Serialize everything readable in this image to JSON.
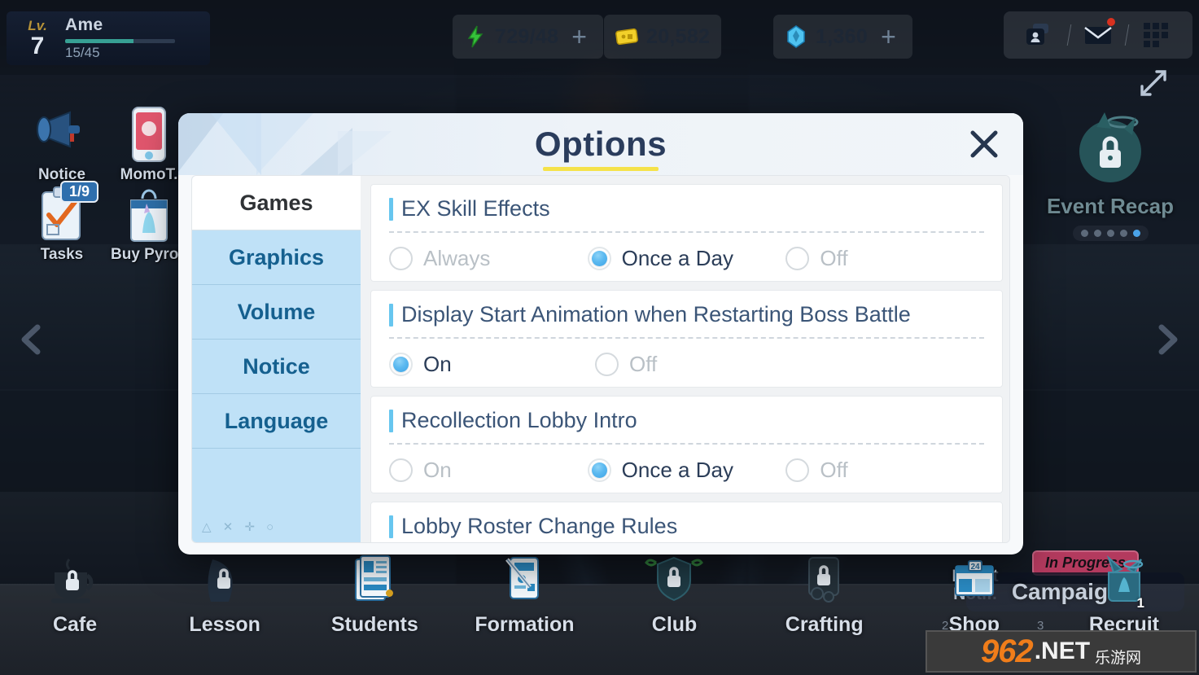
{
  "hud": {
    "player": {
      "lv_word": "Lv.",
      "level": "7",
      "name": "Ame",
      "xp": "15/45"
    },
    "currencies": [
      {
        "name": "ap",
        "icon": "lightning-icon",
        "value": "729/48",
        "plus": "+"
      },
      {
        "name": "credits",
        "icon": "credit-icon",
        "value": "20,582",
        "plus": ""
      },
      {
        "name": "pyroxene",
        "icon": "pyroxene-icon",
        "value": "1,360",
        "plus": "+"
      }
    ],
    "top_right": [
      {
        "name": "friends-icon",
        "label": "Friends"
      },
      {
        "name": "mail-icon",
        "label": "Mail",
        "badge": true
      },
      {
        "name": "menu-grid-icon",
        "label": "Menu"
      }
    ],
    "expand_icon": "expand-arrows-icon"
  },
  "shortcuts": [
    {
      "name": "notice",
      "label": "Notice",
      "icon": "megaphone-icon",
      "badge": ""
    },
    {
      "name": "momotalk",
      "label": "MomoT.",
      "icon": "phone-icon",
      "badge": ""
    },
    {
      "name": "tasks",
      "label": "Tasks",
      "icon": "clipboard-check-icon",
      "badge": "1/9"
    },
    {
      "name": "buy-pyroxene",
      "label": "Buy Pyrox",
      "icon": "pyroxene-bag-icon",
      "badge": ""
    }
  ],
  "right_panel": {
    "label": "Event Recap",
    "locked": true,
    "dots": 5,
    "active_dot": 5
  },
  "event_notif": {
    "line1": "Event",
    "line2": "Notif."
  },
  "campaign": {
    "label": "Campaign",
    "suffix": "x",
    "badge": "In Progress"
  },
  "nav_arrows": {
    "left": "chevron-left-icon",
    "right": "chevron-right-icon"
  },
  "page_numbers": [
    "2",
    "3"
  ],
  "bottom_nav": [
    {
      "name": "cafe",
      "label": "Cafe",
      "icon": "coffee-cup-icon",
      "locked": true,
      "badge": ""
    },
    {
      "name": "lesson",
      "label": "Lesson",
      "icon": "lesson-icon",
      "locked": true,
      "badge": ""
    },
    {
      "name": "students",
      "label": "Students",
      "icon": "students-icon",
      "locked": false,
      "badge": ""
    },
    {
      "name": "formation",
      "label": "Formation",
      "icon": "formation-icon",
      "locked": false,
      "badge": ""
    },
    {
      "name": "club",
      "label": "Club",
      "icon": "club-shield-icon",
      "locked": true,
      "badge": ""
    },
    {
      "name": "crafting",
      "label": "Crafting",
      "icon": "crafting-icon",
      "locked": true,
      "badge": ""
    },
    {
      "name": "shop",
      "label": "Shop",
      "icon": "shop-icon",
      "locked": false,
      "badge": "24"
    },
    {
      "name": "recruit",
      "label": "Recruit",
      "icon": "recruit-icon",
      "locked": false,
      "badge": "1"
    }
  ],
  "watermark": {
    "brand": "962",
    "tld": ".NET",
    "cn": "乐游网"
  },
  "dialog": {
    "title": "Options",
    "close_label": "✕",
    "tabs": [
      {
        "id": "games",
        "label": "Games",
        "active": true
      },
      {
        "id": "graphics",
        "label": "Graphics",
        "active": false
      },
      {
        "id": "volume",
        "label": "Volume",
        "active": false
      },
      {
        "id": "notice",
        "label": "Notice",
        "active": false
      },
      {
        "id": "language",
        "label": "Language",
        "active": false
      }
    ],
    "sidebar_symbols": "△ ✕ ✛ ○",
    "sections": [
      {
        "id": "ex-skill-effects",
        "title": "EX Skill Effects",
        "options": [
          {
            "label": "Always",
            "selected": false
          },
          {
            "label": "Once a Day",
            "selected": true
          },
          {
            "label": "Off",
            "selected": false
          }
        ]
      },
      {
        "id": "display-start-animation",
        "title": "Display Start Animation when Restarting Boss Battle",
        "options": [
          {
            "label": "On",
            "selected": true
          },
          {
            "label": "Off",
            "selected": false
          }
        ]
      },
      {
        "id": "recollection-lobby-intro",
        "title": "Recollection Lobby Intro",
        "options": [
          {
            "label": "On",
            "selected": false
          },
          {
            "label": "Once a Day",
            "selected": true
          },
          {
            "label": "Off",
            "selected": false
          }
        ]
      },
      {
        "id": "lobby-roster-change-rules",
        "title": "Lobby Roster Change Rules",
        "options": []
      }
    ]
  }
}
